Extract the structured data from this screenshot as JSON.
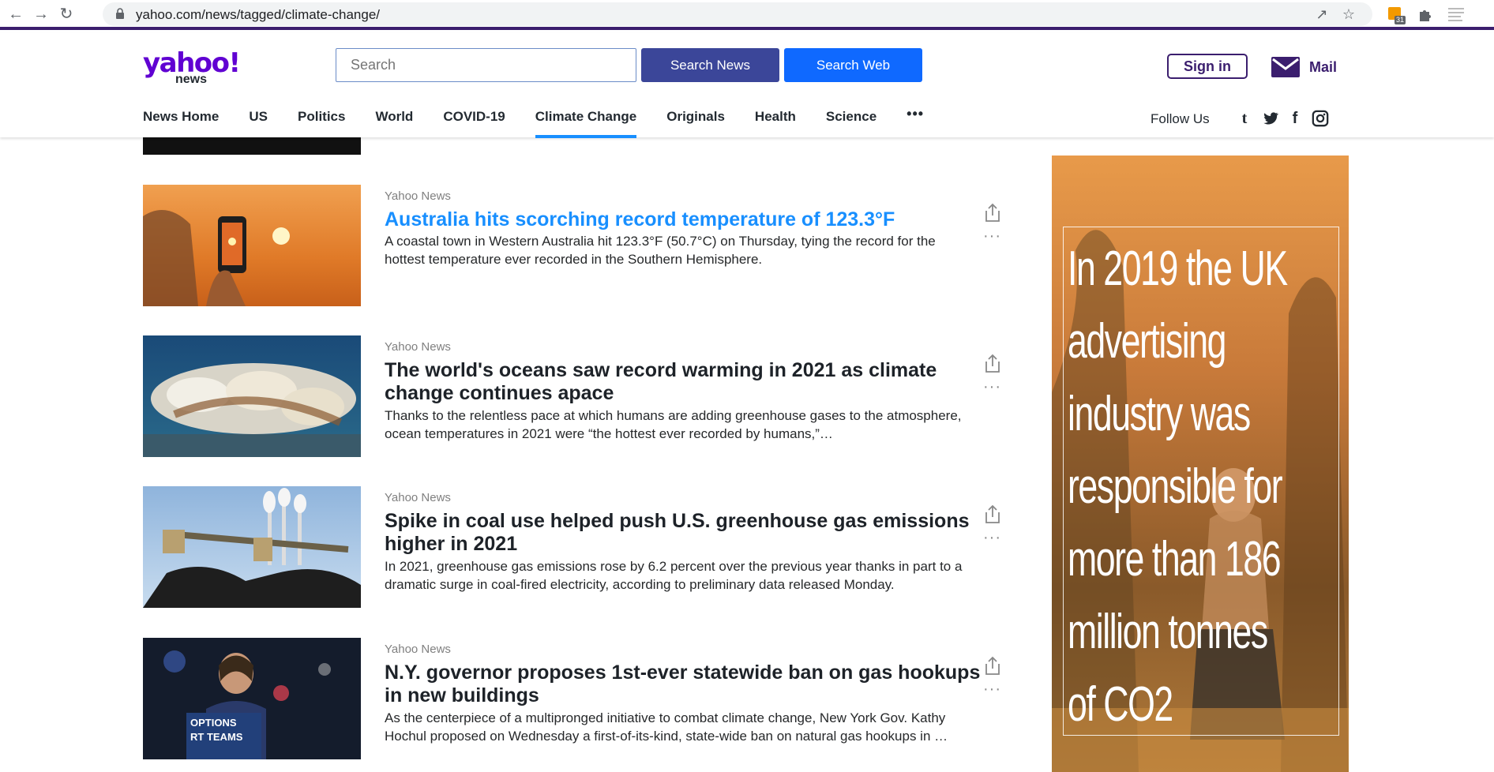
{
  "browser": {
    "url": "yahoo.com/news/tagged/climate-change/",
    "ext_badge": "31"
  },
  "header": {
    "logo_text": "yahoo!",
    "logo_sub": "news",
    "search_placeholder": "Search",
    "search_news_label": "Search News",
    "search_web_label": "Search Web",
    "signin_label": "Sign in",
    "mail_label": "Mail",
    "follow_label": "Follow Us"
  },
  "nav": {
    "items": [
      {
        "label": "News Home"
      },
      {
        "label": "US"
      },
      {
        "label": "Politics"
      },
      {
        "label": "World"
      },
      {
        "label": "COVID-19"
      },
      {
        "label": "Climate Change",
        "active": true
      },
      {
        "label": "Originals"
      },
      {
        "label": "Health"
      },
      {
        "label": "Science"
      }
    ],
    "more_label": "•••"
  },
  "stories": [
    {
      "source": "Yahoo News",
      "headline": "Australia hits scorching record temperature of 123.3°F",
      "summary": "A coastal town in Western Australia hit 123.3°F (50.7°C) on Thursday, tying the record for the hottest temperature ever recorded in the Southern Hemisphere.",
      "highlighted": true
    },
    {
      "source": "Yahoo News",
      "headline": "The world's oceans saw record warming in 2021 as climate change continues apace",
      "summary": "Thanks to the relentless pace at which humans are adding greenhouse gases to the atmosphere, ocean temperatures in 2021 were “the hottest ever recorded by humans,”…"
    },
    {
      "source": "Yahoo News",
      "headline": "Spike in coal use helped push U.S. greenhouse gas emissions higher in 2021",
      "summary": "In 2021, greenhouse gas emissions rose by 6.2 percent over the previous year thanks in part to a dramatic surge in coal-fired electricity, according to preliminary data released Monday."
    },
    {
      "source": "Yahoo News",
      "headline": "N.Y. governor proposes 1st-ever statewide ban on gas hookups in new buildings",
      "summary": "As the centerpiece of a multipronged initiative to combat climate change, New York Gov. Kathy Hochul proposed on Wednesday a first-of-its-kind, state-wide ban on natural gas hookups in …"
    }
  ],
  "ad": {
    "lines": [
      "In 2019 the UK",
      "advertising",
      "industry was",
      "responsible for",
      "more than 186",
      "million tonnes",
      "of CO2"
    ]
  },
  "colors": {
    "brand_purple": "#6001d2",
    "link_blue": "#188fff",
    "search_news_bg": "#3b4699",
    "search_web_bg": "#0f69ff"
  }
}
